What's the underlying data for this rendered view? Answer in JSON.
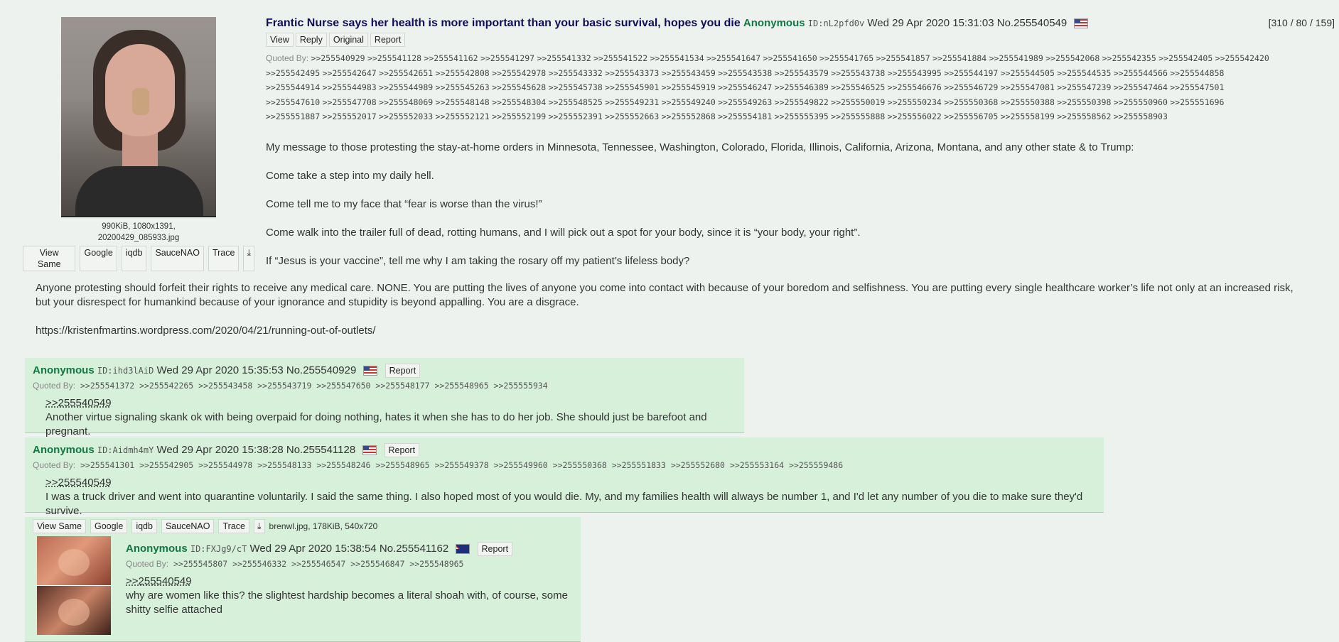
{
  "op": {
    "subject": "Frantic Nurse says her health is more important than your basic survival, hopes you die",
    "name": "Anonymous",
    "poster_id": "ID:nL2pfd0v",
    "date": "Wed 29 Apr 2020 15:31:03",
    "post_no": "No.255540549",
    "flag": "us-flag",
    "counts": "[310 / 80 / 159]",
    "buttons": {
      "view": "View",
      "reply": "Reply",
      "original": "Original",
      "report": "Report"
    },
    "file": {
      "info_line1": "990KiB, 1080x1391,",
      "info_line2": "20200429_085933.jpg",
      "search": {
        "view_same": "View Same",
        "google": "Google",
        "iqdb": "iqdb",
        "saucenao": "SauceNAO",
        "trace": "Trace"
      }
    },
    "quoted_by_label": "Quoted By:",
    "quoted_by": [
      ">>255540929",
      ">>255541128",
      ">>255541162",
      ">>255541297",
      ">>255541332",
      ">>255541522",
      ">>255541534",
      ">>255541647",
      ">>255541650",
      ">>255541765",
      ">>255541857",
      ">>255541884",
      ">>255541989",
      ">>255542068",
      ">>255542355",
      ">>255542405",
      ">>255542420",
      ">>255542495",
      ">>255542647",
      ">>255542651",
      ">>255542808",
      ">>255542978",
      ">>255543332",
      ">>255543373",
      ">>255543459",
      ">>255543538",
      ">>255543579",
      ">>255543738",
      ">>255543995",
      ">>255544197",
      ">>255544505",
      ">>255544535",
      ">>255544566",
      ">>255544858",
      ">>255544914",
      ">>255544983",
      ">>255544989",
      ">>255545263",
      ">>255545628",
      ">>255545738",
      ">>255545901",
      ">>255545919",
      ">>255546247",
      ">>255546389",
      ">>255546525",
      ">>255546676",
      ">>255546729",
      ">>255547081",
      ">>255547239",
      ">>255547464",
      ">>255547501",
      ">>255547610",
      ">>255547708",
      ">>255548069",
      ">>255548148",
      ">>255548304",
      ">>255548525",
      ">>255549231",
      ">>255549240",
      ">>255549263",
      ">>255549822",
      ">>255550019",
      ">>255550234",
      ">>255550368",
      ">>255550388",
      ">>255550398",
      ">>255550960",
      ">>255551696",
      ">>255551887",
      ">>255552017",
      ">>255552033",
      ">>255552121",
      ">>255552199",
      ">>255552391",
      ">>255552663",
      ">>255552868",
      ">>255554181",
      ">>255555395",
      ">>255555888",
      ">>255556022",
      ">>255556705",
      ">>255558199",
      ">>255558562",
      ">>255558903"
    ],
    "body": [
      "My message to those protesting the stay-at-home orders in Minnesota, Tennessee, Washington, Colorado, Florida, Illinois, California, Arizona, Montana, and any other state & to Trump:",
      "Come take a step into my daily hell.",
      "Come tell me to my face that “fear is worse than the virus!”",
      "Come walk into the trailer full of dead, rotting humans, and I will pick out a spot for your body, since it is “your body, your right”.",
      "If “Jesus is your vaccine”, tell me why I am taking the rosary off my patient’s lifeless body?"
    ],
    "body2": [
      "Anyone protesting should forfeit their rights to receive any medical care. NONE. You are putting the lives of anyone you come into contact with because of your boredom and selfishness. You are putting every single healthcare worker’s life not only at an increased risk, but your disrespect for humankind because of your ignorance and stupidity is beyond appalling. You are a disgrace.",
      "https://kristenfmartins.wordpress.com/2020/04/21/running-out-of-outlets/"
    ]
  },
  "replies": [
    {
      "name": "Anonymous",
      "poster_id": "ID:ihd3lAiD",
      "date": "Wed 29 Apr 2020 15:35:53",
      "post_no": "No.255540929",
      "report": "Report",
      "quoted_by_label": "Quoted By:",
      "quoted_by": ">>255541372 >>255542265 >>255543458 >>255543719 >>255547650 >>255548177 >>255548965 >>255555934",
      "backlink": ">>255540549",
      "text": "Another virtue signaling skank ok with being overpaid for doing nothing, hates it when she has to do her job. She should just be barefoot and pregnant."
    },
    {
      "name": "Anonymous",
      "poster_id": "ID:Aidmh4mY",
      "date": "Wed 29 Apr 2020 15:38:28",
      "post_no": "No.255541128",
      "report": "Report",
      "quoted_by_label": "Quoted By:",
      "quoted_by": ">>255541301 >>255542905 >>255544978 >>255548133 >>255548246 >>255548965 >>255549378 >>255549960 >>255550368 >>255551833 >>255552680 >>255553164 >>255559486",
      "backlink": ">>255540549",
      "text": "I was a truck driver and went into quarantine voluntarily. I said the same thing. I also hoped most of you would die. My, and my families health will always be number 1, and I'd let any number of you die to make sure they'd survive."
    },
    {
      "search": {
        "view_same": "View Same",
        "google": "Google",
        "iqdb": "iqdb",
        "saucenao": "SauceNAO",
        "trace": "Trace"
      },
      "file_info": "brenwl.jpg, 178KiB, 540x720",
      "name": "Anonymous",
      "poster_id": "ID:FXJg9/cT",
      "date": "Wed 29 Apr 2020 15:38:54",
      "post_no": "No.255541162",
      "report": "Report",
      "quoted_by_label": "Quoted By:",
      "quoted_by": ">>255545807 >>255546332 >>255546547 >>255546847 >>255548965",
      "backlink": ">>255540549",
      "text": "why are women like this? the slightest hardship becomes a literal shoah with, of course, some shitty selfie attached"
    }
  ]
}
